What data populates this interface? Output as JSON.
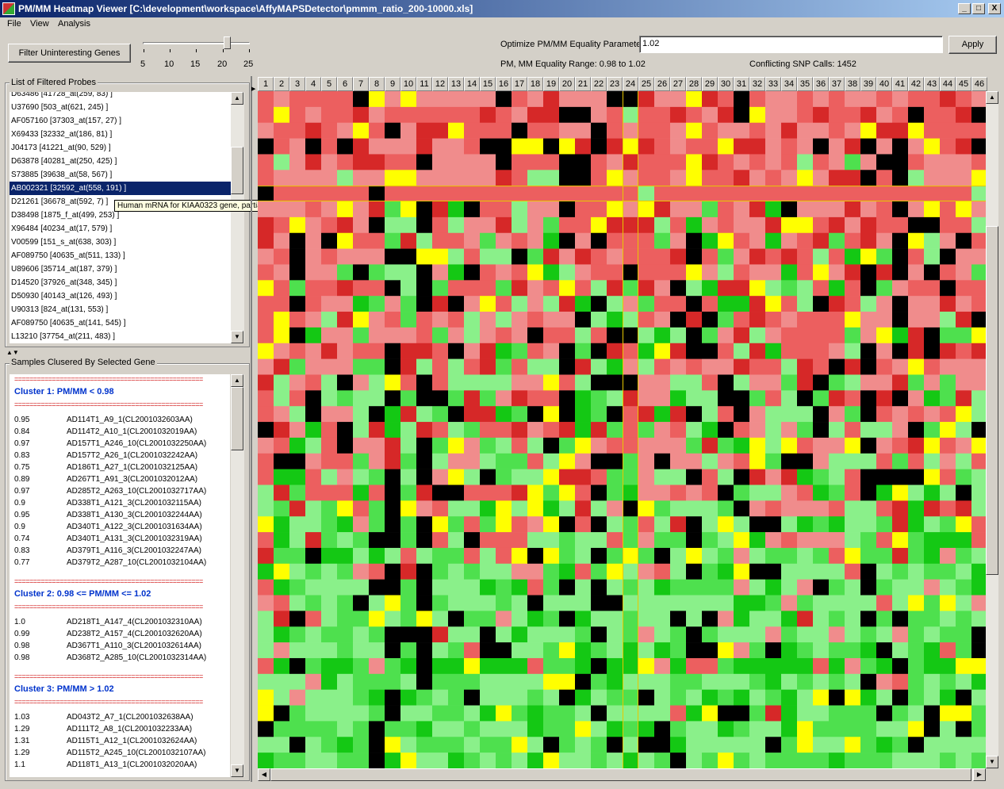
{
  "window": {
    "title": "PM/MM Heatmap Viewer [C:\\development\\workspace\\AffyMAPSDetector\\pmmm_ratio_200-10000.xls]",
    "min_label": "_",
    "max_label": "□",
    "close_label": "X"
  },
  "menu": [
    "File",
    "View",
    "Analysis"
  ],
  "toolbar": {
    "filter_button": "Filter Uninteresting Genes",
    "slider": {
      "ticks": [
        "5",
        "10",
        "15",
        "20",
        "25"
      ],
      "value": 20
    },
    "optimize_label": "Optimize PM/MM Equality Parameter:",
    "optimize_value": "1.02",
    "apply_button": "Apply",
    "range_label": "PM, MM Equality Range: 0.98 to 1.02",
    "snp_label": "Conflicting SNP Calls: 1452"
  },
  "probes": {
    "title": "List of Filtered Probes",
    "selected_index": 7,
    "items": [
      "D63486 [41728_at(259, 83) ]",
      "U37690 [503_at(621, 245) ]",
      "AF057160 [37303_at(157, 27) ]",
      "X69433 [32332_at(186, 81) ]",
      "J04173 [41221_at(90, 529) ]",
      "D63878 [40281_at(250, 425) ]",
      "S73885 [39638_at(58, 567) ]",
      "AB002321 [32592_at(558, 191) ]",
      "D21261 [36678_at(592, 7) ]",
      "D38498 [1875_f_at(499, 253) ]",
      "X96484 [40234_at(17, 579) ]",
      "V00599 [151_s_at(638, 303) ]",
      "AF089750 [40635_at(511, 133) ]",
      "U89606 [35714_at(187, 379) ]",
      "D14520 [37926_at(348, 345) ]",
      "D50930 [40143_at(126, 493) ]",
      "U90313 [824_at(131, 553) ]",
      "AF089750 [40635_at(141, 545) ]",
      "L13210 [37754_at(211, 483) ]"
    ],
    "tooltip": "Human mRNA for KIAA0323 gene, partial cds"
  },
  "clusters": {
    "title": "Samples Clusered By Selected Gene",
    "separator": "==================================================",
    "groups": [
      {
        "heading": "Cluster 1: PM/MM < 0.98",
        "rows": [
          {
            "v": "0.95",
            "s": "AD114T1_A9_1(CL2001032603AA)"
          },
          {
            "v": "0.84",
            "s": "AD114T2_A10_1(CL2001032019AA)"
          },
          {
            "v": "0.97",
            "s": "AD157T1_A246_10(CL2001032250AA)"
          },
          {
            "v": "0.83",
            "s": "AD157T2_A26_1(CL2001032242AA)"
          },
          {
            "v": "0.75",
            "s": "AD186T1_A27_1(CL2001032125AA)"
          },
          {
            "v": "0.89",
            "s": "AD267T1_A91_3(CL2001032012AA)"
          },
          {
            "v": "0.97",
            "s": "AD285T2_A263_10(CL2001032717AA)"
          },
          {
            "v": "0.9",
            "s": "AD338T1_A121_3(CL2001032115AA)"
          },
          {
            "v": "0.95",
            "s": "AD338T1_A130_3(CL2001032244AA)"
          },
          {
            "v": "0.9",
            "s": "AD340T1_A122_3(CL2001031634AA)"
          },
          {
            "v": "0.74",
            "s": "AD340T1_A131_3(CL2001032319AA)"
          },
          {
            "v": "0.83",
            "s": "AD379T1_A116_3(CL2001032247AA)"
          },
          {
            "v": "0.77",
            "s": "AD379T2_A287_10(CL2001032104AA)"
          }
        ]
      },
      {
        "heading": "Cluster 2: 0.98 <= PM/MM <= 1.02",
        "rows": [
          {
            "v": "1.0",
            "s": "AD218T1_A147_4(CL2001032310AA)"
          },
          {
            "v": "0.99",
            "s": "AD238T2_A157_4(CL2001032620AA)"
          },
          {
            "v": "0.98",
            "s": "AD367T1_A110_3(CL2001032614AA)"
          },
          {
            "v": "0.98",
            "s": "AD368T2_A285_10(CL2001032314AA)"
          }
        ]
      },
      {
        "heading": "Cluster 3: PM/MM > 1.02",
        "rows": [
          {
            "v": "1.03",
            "s": "AD043T2_A7_1(CL2001032638AA)"
          },
          {
            "v": "1.29",
            "s": "AD111T2_A8_1(CL2001032233AA)"
          },
          {
            "v": "1.31",
            "s": "AD115T1_A12_1(CL2001032624AA)"
          },
          {
            "v": "1.29",
            "s": "AD115T2_A245_10(CL2001032107AA)"
          },
          {
            "v": "1.1",
            "s": "AD118T1_A13_1(CL2001032020AA)"
          }
        ]
      }
    ]
  },
  "heatmap": {
    "columns": [
      "1",
      "2",
      "3",
      "4",
      "5",
      "6",
      "7",
      "8",
      "9",
      "10",
      "11",
      "12",
      "13",
      "14",
      "15",
      "16",
      "17",
      "18",
      "19",
      "20",
      "21",
      "22",
      "23",
      "24",
      "25",
      "26",
      "27",
      "28",
      "29",
      "30",
      "31",
      "32",
      "33",
      "34",
      "35",
      "36",
      "37",
      "38",
      "39",
      "40",
      "41",
      "42",
      "43",
      "44",
      "45",
      "46"
    ],
    "visible_rows": 43,
    "highlight_row": 6,
    "highlight_col": 23,
    "colors": {
      "red_dark": "#d62828",
      "red": "#ec5f5f",
      "red_light": "#f08c8c",
      "green_dark": "#14c814",
      "green": "#4ee04e",
      "green_light": "#8af08a",
      "yellow": "#ffff00",
      "black": "#000000",
      "crosshair": "#e8c800"
    }
  }
}
